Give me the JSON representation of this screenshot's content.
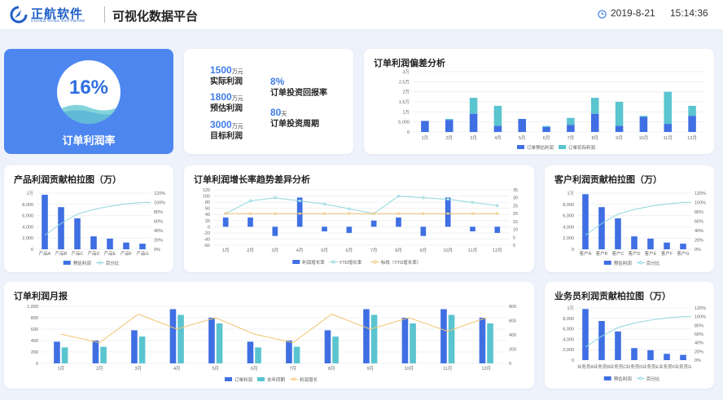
{
  "header": {
    "brand": "正航软件",
    "brand_sub": "CHANG HANG SOFTWARE",
    "title": "可视化数据平台",
    "date": "2019-8-21",
    "time": "15:14:36"
  },
  "kpi": {
    "percent": "16%",
    "label": "订单利润率"
  },
  "stats": [
    {
      "value": "1500",
      "unit": "万元",
      "label": "实际利润"
    },
    {
      "value": "1800",
      "unit": "万元",
      "label": "预估利润"
    },
    {
      "value": "3000",
      "unit": "万元",
      "label": "目标利润"
    },
    {
      "value": "8%",
      "unit": "",
      "label": "订单投资回报率"
    },
    {
      "value": "80",
      "unit": "天",
      "label": "订单投资周期"
    }
  ],
  "colors": {
    "blue": "#3f6fe3",
    "teal": "#5ac4cf",
    "line": "#8fd6de",
    "orange": "#f3c46f",
    "kpi_bg": "#4d86ef"
  },
  "chart_data": [
    {
      "id": "deviation",
      "type": "bar",
      "title": "订单利润偏差分析",
      "categories": [
        "1月",
        "2月",
        "3月",
        "4月",
        "5月",
        "6月",
        "7月",
        "8月",
        "9月",
        "10月",
        "11月",
        "12月"
      ],
      "yticks": [
        "0",
        "5,000",
        "1万",
        "1.5万",
        "2万",
        "2.5万",
        "3万"
      ],
      "ylim": [
        0,
        30000
      ],
      "series": [
        {
          "name": "订单预估利润",
          "values": [
            5500,
            6000,
            9000,
            3000,
            6500,
            2500,
            3500,
            9000,
            3000,
            7500,
            4000,
            8000
          ]
        },
        {
          "name": "订单实际利润",
          "values": [
            5500,
            6500,
            17000,
            13000,
            6000,
            3000,
            7000,
            17000,
            15000,
            8000,
            20000,
            13000
          ]
        }
      ],
      "stacked": true
    },
    {
      "id": "product-pareto",
      "type": "bar",
      "title": "产品利润贡献柏拉图（万）",
      "categories": [
        "产品A",
        "产品B",
        "产品C",
        "产品D",
        "产品E",
        "产品F",
        "产品G"
      ],
      "yticks": [
        "0",
        "2,000",
        "4,000",
        "6,000",
        "8,000",
        "1万"
      ],
      "ylim": [
        0,
        10000
      ],
      "y2ticks": [
        "0%",
        "20%",
        "40%",
        "60%",
        "80%",
        "100%",
        "120%"
      ],
      "y2lim": [
        0,
        120
      ],
      "series": [
        {
          "name": "预估利润",
          "values": [
            9700,
            7500,
            5500,
            2300,
            1900,
            1200,
            1000
          ]
        },
        {
          "name": "百分比",
          "values": [
            30,
            55,
            75,
            85,
            92,
            97,
            100
          ]
        }
      ]
    },
    {
      "id": "growth-trend",
      "type": "bar",
      "title": "订单利润增长率趋势差异分析",
      "categories": [
        "1月",
        "2月",
        "3月",
        "4月",
        "5月",
        "6月",
        "7月",
        "8月",
        "9月",
        "10月",
        "11月",
        "12月"
      ],
      "yticks": [
        "-60",
        "-40",
        "-20",
        "0",
        "20",
        "40",
        "60",
        "80",
        "100",
        "120"
      ],
      "ylim": [
        -60,
        120
      ],
      "y2ticks": [
        "0",
        "5",
        "10",
        "15",
        "20",
        "25",
        "30",
        "35"
      ],
      "y2lim": [
        0,
        35
      ],
      "series": [
        {
          "name": "利润增长率",
          "values": [
            30,
            30,
            -30,
            95,
            -15,
            -20,
            20,
            30,
            -30,
            95,
            -15,
            -20
          ]
        },
        {
          "name": "YTD增长率",
          "values": [
            20,
            28,
            30,
            28,
            26,
            23,
            20,
            31,
            30,
            29,
            27,
            25
          ]
        },
        {
          "name": "标线（YTD增长率）",
          "values": [
            20,
            20,
            20,
            20,
            20,
            20,
            20,
            20,
            20,
            20,
            20,
            20
          ]
        }
      ]
    },
    {
      "id": "customer-pareto",
      "type": "bar",
      "title": "客户利润贡献柏拉图（万）",
      "categories": [
        "客户A",
        "客户B",
        "客户C",
        "客户D",
        "客户E",
        "客户F",
        "客户G"
      ],
      "yticks": [
        "0",
        "2,000",
        "4,000",
        "6,000",
        "8,000",
        "1万"
      ],
      "ylim": [
        0,
        10000
      ],
      "y2ticks": [
        "0%",
        "20%",
        "40%",
        "60%",
        "80%",
        "100%",
        "120%"
      ],
      "y2lim": [
        0,
        120
      ],
      "series": [
        {
          "name": "预估利润",
          "values": [
            9800,
            7500,
            5500,
            2300,
            1900,
            1200,
            1000
          ]
        },
        {
          "name": "百分比",
          "values": [
            30,
            55,
            75,
            85,
            92,
            97,
            100
          ]
        }
      ]
    },
    {
      "id": "monthly",
      "type": "bar",
      "title": "订单利润月报",
      "categories": [
        "1月",
        "2月",
        "3月",
        "4月",
        "5月",
        "6月",
        "7月",
        "8月",
        "9月",
        "10月",
        "11月",
        "12月"
      ],
      "yticks": [
        "0",
        "200",
        "400",
        "600",
        "800",
        "1,000"
      ],
      "ylim": [
        0,
        1000
      ],
      "y2ticks": [
        "0",
        "200",
        "400",
        "600",
        "800"
      ],
      "y2lim": [
        0,
        800
      ],
      "series": [
        {
          "name": "订单利润",
          "values": [
            380,
            400,
            580,
            950,
            800,
            380,
            400,
            580,
            950,
            800,
            950,
            800
          ]
        },
        {
          "name": "去年同期",
          "values": [
            280,
            290,
            470,
            850,
            700,
            280,
            290,
            470,
            850,
            700,
            850,
            700
          ]
        },
        {
          "name": "利润增长",
          "values": [
            410,
            290,
            690,
            480,
            640,
            410,
            290,
            690,
            480,
            640,
            450,
            640
          ]
        }
      ]
    },
    {
      "id": "salesman-pareto",
      "type": "bar",
      "title": "业务员利润贡献柏拉图（万）",
      "categories": [
        "业务员A",
        "业务员B",
        "业务员C",
        "业务员D",
        "业务员E",
        "业务员F",
        "业务员G"
      ],
      "yticks": [
        "0",
        "2,000",
        "4,000",
        "6,000",
        "8,000",
        "1万"
      ],
      "ylim": [
        0,
        10000
      ],
      "y2ticks": [
        "0%",
        "20%",
        "40%",
        "60%",
        "80%",
        "100%",
        "120%"
      ],
      "y2lim": [
        0,
        120
      ],
      "series": [
        {
          "name": "预估利润",
          "values": [
            9800,
            7500,
            5500,
            2300,
            1900,
            1200,
            1000
          ]
        },
        {
          "name": "百分比",
          "values": [
            30,
            55,
            75,
            85,
            92,
            97,
            100
          ]
        }
      ]
    }
  ]
}
